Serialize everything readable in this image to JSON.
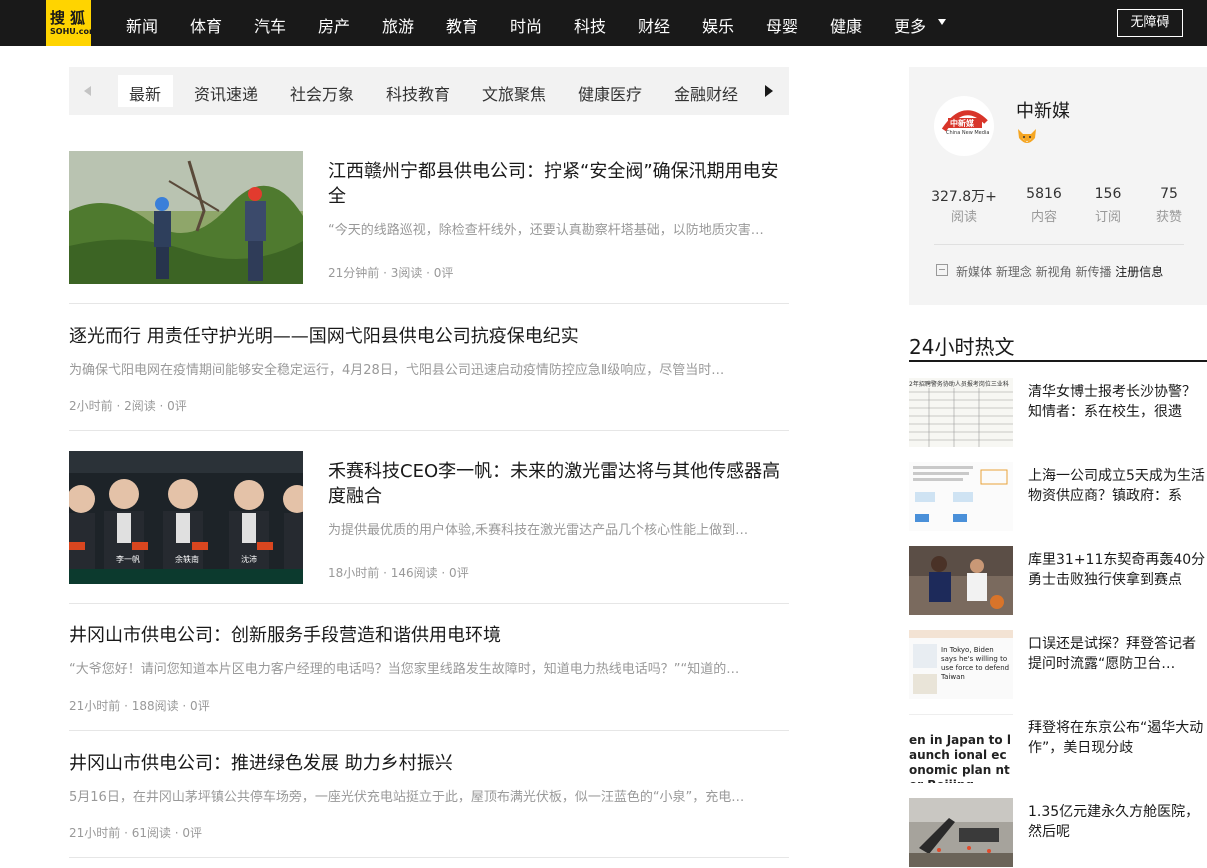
{
  "logo": {
    "cn": "搜狐",
    "en": "SOHU.com",
    "color": "#ffd400"
  },
  "nav": {
    "items": [
      "新闻",
      "体育",
      "汽车",
      "房产",
      "旅游",
      "教育",
      "时尚",
      "科技",
      "财经",
      "娱乐",
      "母婴",
      "健康",
      "更多"
    ],
    "accessibility_label": "无障碍"
  },
  "tabs": {
    "items": [
      "最新",
      "资讯速递",
      "社会万象",
      "科技教育",
      "文旅聚焦",
      "健康医疗",
      "金融财经"
    ],
    "active": "最新"
  },
  "articles": [
    {
      "title": "江西赣州宁都县供电公司：拧紧“安全阀”确保汛期用电安全",
      "desc": "“今天的线路巡视，除检查杆线外，还要认真勘察杆塔基础，以防地质灾害…",
      "meta": "21分钟前 · 3阅读 · 0评"
    },
    {
      "title": "逐光而行 用责任守护光明——国网弋阳县供电公司抗疫保电纪实",
      "desc": "为确保弋阳电网在疫情期间能够安全稳定运行，4月28日，弋阳县公司迅速启动疫情防控应急Ⅱ级响应，尽管当时…",
      "meta": "2小时前 · 2阅读 · 0评"
    },
    {
      "title": "禾赛科技CEO李一帆：未来的激光雷达将与其他传感器高度融合",
      "desc": "为提供最优质的用户体验,禾赛科技在激光雷达产品几个核心性能上做到…",
      "meta": "18小时前 · 146阅读 · 0评",
      "thumb_labels": [
        "嘉宾",
        "李一帆",
        "嘉宾",
        "余轶南",
        "嘉宾",
        "沈沛",
        "嘉宾"
      ]
    },
    {
      "title": "井冈山市供电公司：创新服务手段营造和谐供用电环境",
      "desc": "“大爷您好！请问您知道本片区电力客户经理的电话吗？当您家里线路发生故障时，知道电力热线电话吗？”“知道的…",
      "meta": "21小时前 · 188阅读 · 0评"
    },
    {
      "title": "井冈山市供电公司：推进绿色发展 助力乡村振兴",
      "desc": "5月16日，在井冈山茅坪镇公共停车场旁，一座光伏充电站挺立于此，屋顶布满光伏板，似一汪蓝色的“小泉”，充电…",
      "meta": "21小时前 · 61阅读 · 0评"
    }
  ],
  "author": {
    "name": "中新媒",
    "avatar_text": "中新媒",
    "avatar_sub": "China New Media",
    "stats": [
      {
        "value": "327.8万+",
        "label": "阅读"
      },
      {
        "value": "5816",
        "label": "内容"
      },
      {
        "value": "156",
        "label": "订阅"
      },
      {
        "value": "75",
        "label": "获赞"
      }
    ],
    "desc": "新媒体 新理念 新视角 新传播",
    "reg_link": "注册信息"
  },
  "hot": {
    "title": "24小时热文",
    "items": [
      {
        "title": "清华女博士报考长沙协警？知情者：系在校生，很遗憾…",
        "thumb_text": "2年招聘警务协助人员报考岗位三业科"
      },
      {
        "title": "上海一公司成立5天成为生活物资供应商？镇政府：系此…",
        "thumb_text": ""
      },
      {
        "title": "库里31+11东契奇再轰40分 勇士击败独行侠拿到赛点",
        "thumb_text": ""
      },
      {
        "title": "口误还是试探？拜登答记者提问时流露“愿防卫台…",
        "thumb_text": "In Tokyo, Biden says he's willing to use force to defend Taiwan"
      },
      {
        "title": "拜登将在东京公布“遏华大动作”，美日现分歧",
        "thumb_text": "en in Japan to launch ional economic plan nter Beijing"
      },
      {
        "title": "1.35亿元建永久方舱医院，然后呢",
        "thumb_text": ""
      }
    ]
  }
}
